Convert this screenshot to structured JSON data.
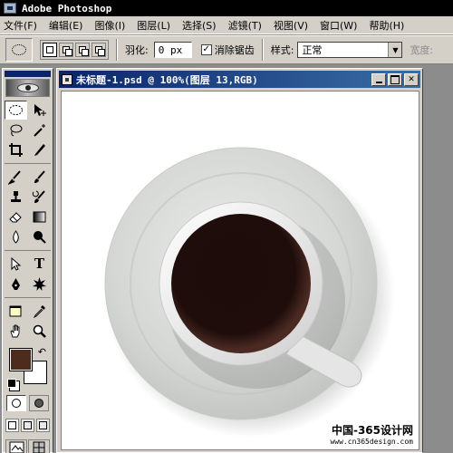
{
  "app": {
    "title": "Adobe Photoshop"
  },
  "menu": [
    "文件(F)",
    "编辑(E)",
    "图像(I)",
    "图层(L)",
    "选择(S)",
    "滤镜(T)",
    "视图(V)",
    "窗口(W)",
    "帮助(H)"
  ],
  "options": {
    "feather_label": "羽化:",
    "feather_value": "0 px",
    "antialias_checked": "✓",
    "antialias_label": "消除锯齿",
    "style_label": "样式:",
    "style_value": "正常",
    "width_label": "宽度:"
  },
  "toolbox": {
    "tools": [
      "elliptical-marquee-tool",
      "move-tool",
      "lasso-tool",
      "magic-wand-tool",
      "crop-tool",
      "slice-tool",
      "healing-brush-tool",
      "brush-tool",
      "clone-stamp-tool",
      "history-brush-tool",
      "eraser-tool",
      "gradient-tool",
      "blur-tool",
      "dodge-tool",
      "path-selection-tool",
      "type-tool",
      "pen-tool",
      "custom-shape-tool",
      "notes-tool",
      "eyedropper-tool",
      "hand-tool",
      "zoom-tool"
    ],
    "type_tool_glyph": "T",
    "foreground_color": "#4e2c1d",
    "background_color": "#ffffff"
  },
  "document": {
    "title": "未标题-1.psd @ 100%(图层 13,RGB)"
  },
  "canvas": {
    "background": "#ffffff",
    "saucer_color": "#d6d8d6",
    "cup_color": "#eeeeee",
    "coffee_color": "#1e0e0c"
  },
  "watermark": {
    "text": "中国-365设计网",
    "url": "www.cn365design.com"
  },
  "window_buttons": {
    "close": "✕"
  }
}
